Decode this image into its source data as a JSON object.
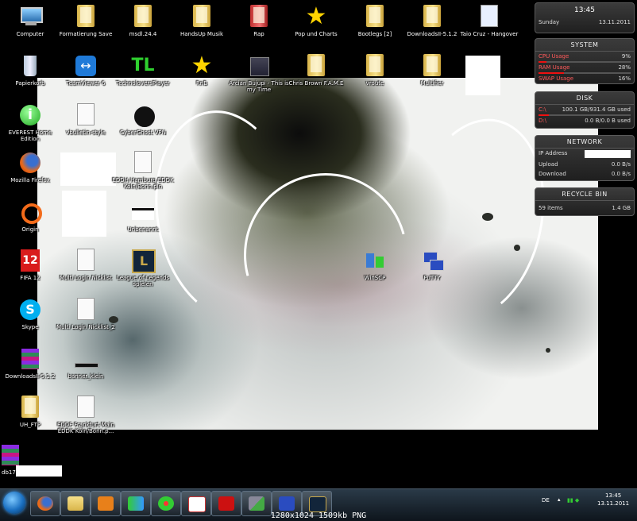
{
  "desktop_icons": [
    {
      "label": "Computer"
    },
    {
      "label": "Formatierung Save"
    },
    {
      "label": "msdl.24.4"
    },
    {
      "label": "HandsUp Musik"
    },
    {
      "label": "Rap"
    },
    {
      "label": "Pop und Charts"
    },
    {
      "label": "Bootlegs [2]"
    },
    {
      "label": "DownloadsII-5.1.2"
    },
    {
      "label": "Taio Cruz - Hangover"
    },
    {
      "label": "Papierkorb"
    },
    {
      "label": "TeamViewer 6"
    },
    {
      "label": "TechnoloversPlayer"
    },
    {
      "label": "RnB"
    },
    {
      "label": "Arcian Bujupi - This is my Time"
    },
    {
      "label": "Chris Brown F.A.M.E"
    },
    {
      "label": "vroute"
    },
    {
      "label": "Multifier"
    },
    {
      "label": "EVEREST Home Edition"
    },
    {
      "label": "vbulletin-style"
    },
    {
      "label": "CyberGhost VPN"
    },
    {
      "label": "Mozilla Firefox"
    },
    {
      "label": "EDDH Hamburg EDDK Köln/Bonn.pln"
    },
    {
      "label": "Origin"
    },
    {
      "label": "Unbenannt"
    },
    {
      "label": "FIFA 12"
    },
    {
      "label": "Multi Login Nicklist"
    },
    {
      "label": "League of Legends spielen"
    },
    {
      "label": "WinSCP"
    },
    {
      "label": "PuTTY"
    },
    {
      "label": "Skype"
    },
    {
      "label": "Multi Login Nicklist_2"
    },
    {
      "label": "DownloadsII-5.1.2"
    },
    {
      "label": "banner_klein"
    },
    {
      "label": "UH_FTP"
    },
    {
      "label": "EDDF Frankfurt Main EDDK Köln/Bonn.p..."
    },
    {
      "label": "db17"
    }
  ],
  "clock": {
    "time": "13:45",
    "day": "Sunday",
    "date": "13.11.2011"
  },
  "system": {
    "title": "SYSTEM",
    "cpu_label": "CPU Usage",
    "cpu": "9%",
    "ram_label": "RAM Usage",
    "ram": "28%",
    "swap_label": "SWAP Usage",
    "swap": "16%",
    "cpu_pct": 0.09,
    "ram_pct": 0.28,
    "swap_pct": 0.16
  },
  "disk": {
    "title": "DISK",
    "c_label": "C:\\",
    "c_value": "100.1 GB/931.4 GB used",
    "d_label": "D:\\",
    "d_value": "0.0 B/0.0 B used",
    "c_pct": 0.11,
    "d_pct": 0.0
  },
  "network": {
    "title": "NETWORK",
    "ip_label": "IP Address",
    "upload_label": "Upload",
    "upload": "0.0 B/s",
    "download_label": "Download",
    "download": "0.0 B/s"
  },
  "recycle": {
    "title": "RECYCLE BIN",
    "items": "59 items",
    "size": "1.4 GB"
  },
  "tray": {
    "lang": "DE",
    "time": "13:45",
    "date": "13.11.2011"
  },
  "caption": "1280x1024 1509kb PNG",
  "colors": {
    "accent": "#e11111",
    "gadget_bg": "#2a2a2a",
    "taskbar": "#1c2833"
  }
}
